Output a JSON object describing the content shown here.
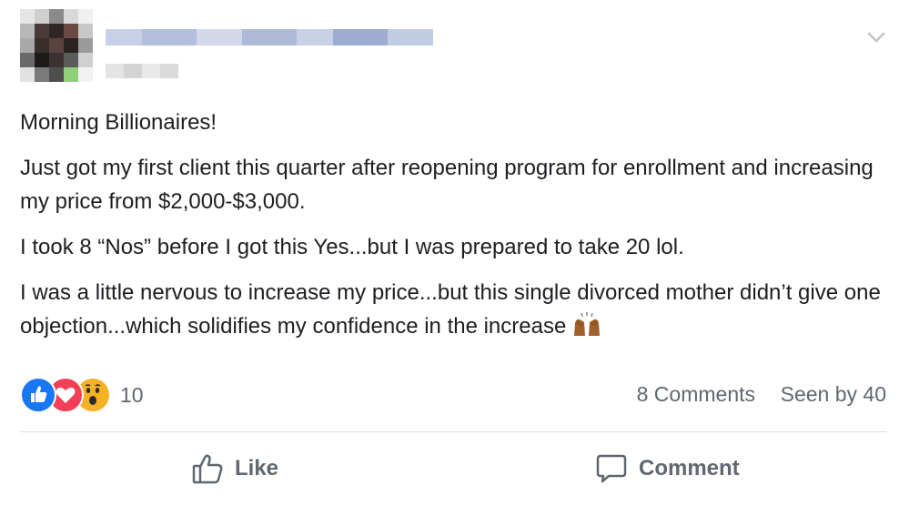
{
  "post": {
    "author_name": "",
    "paragraphs": [
      "Morning Billionaires!",
      "Just got my first client this quarter after reopening program for enrollment and increasing my price from $2,000-$3,000.",
      "I took 8 “Nos” before I got this Yes...but I was prepared to take 20 lol.",
      "I was a little nervous to increase my price...but this single divorced mother didn’t give one objection...which solidifies my confidence in the increase"
    ],
    "trailing_emoji": "raising-hands-emoji"
  },
  "stats": {
    "reactions": [
      "like",
      "love",
      "wow"
    ],
    "reaction_count": "10",
    "comments": "8 Comments",
    "seen_by": "Seen by 40"
  },
  "actions": {
    "like_label": "Like",
    "comment_label": "Comment"
  },
  "colors": {
    "like_blue": "#1877f2",
    "love_red": "#f33e58",
    "wow_yellow": "#f7b125",
    "muted_text": "#606770",
    "divider": "#dadde1"
  }
}
